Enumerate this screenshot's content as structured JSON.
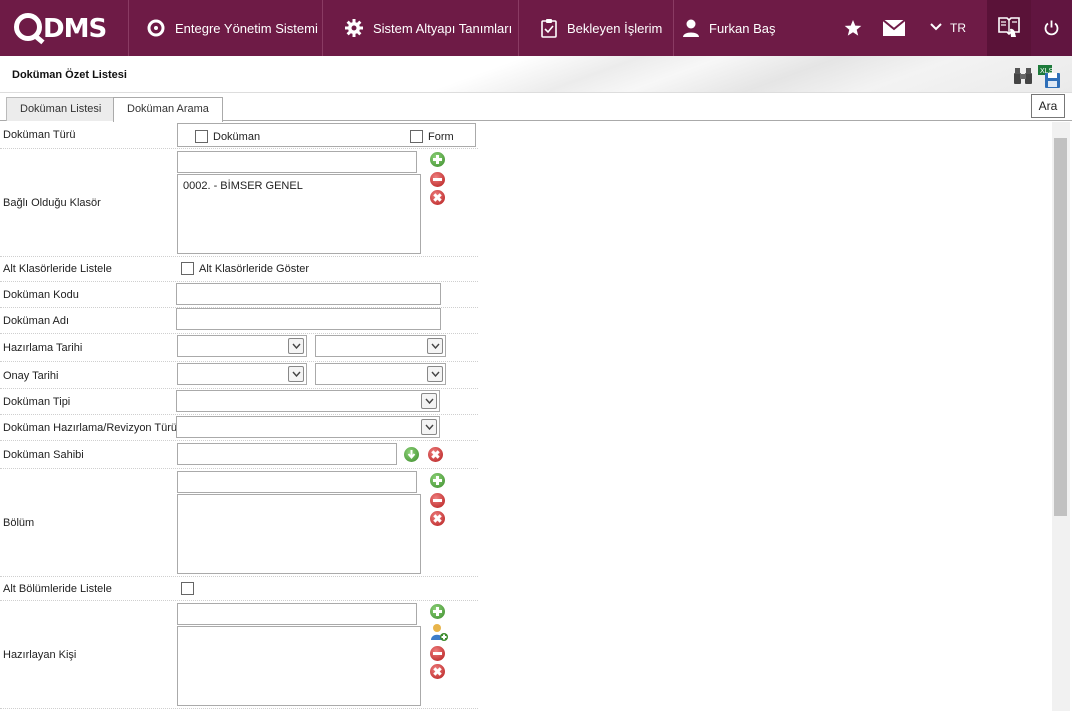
{
  "app": {
    "logo": "QDMS",
    "nav": [
      {
        "label": "Entegre Yönetim Sistemi",
        "icon": "q-logo-icon"
      },
      {
        "label": "Sistem Altyapı Tanımları",
        "icon": "gear-icon"
      },
      {
        "label": "Bekleyen İşlerim",
        "icon": "clipboard-icon"
      },
      {
        "label": "Furkan Baş",
        "icon": "user-icon"
      }
    ],
    "language": "TR",
    "brand_color": "#6e1b46"
  },
  "page": {
    "title": "Doküman Özet Listesi",
    "search_tooltip": "Ara"
  },
  "tabs": [
    {
      "label": "Doküman Listesi",
      "active": false
    },
    {
      "label": "Doküman Arama",
      "active": true
    }
  ],
  "form": {
    "doc_type": {
      "label": "Doküman Türü",
      "option1": "Doküman",
      "option2": "Form"
    },
    "folder": {
      "label": "Bağlı Olduğu Klasör",
      "items": [
        "0002. - BİMSER GENEL"
      ]
    },
    "list_subfolders": {
      "label": "Alt Klasörleride Listele",
      "checkbox_label": "Alt Klasörleride Göster"
    },
    "doc_code": {
      "label": "Doküman Kodu",
      "value": ""
    },
    "doc_name": {
      "label": "Doküman Adı",
      "value": ""
    },
    "prep_date": {
      "label": "Hazırlama Tarihi"
    },
    "approval_date": {
      "label": "Onay Tarihi"
    },
    "doc_kind": {
      "label": "Doküman Tipi"
    },
    "revision_type": {
      "label": "Doküman Hazırlama/Revizyon Türü"
    },
    "doc_owner": {
      "label": "Doküman Sahibi"
    },
    "department": {
      "label": "Bölüm"
    },
    "list_subdepartments": {
      "label": "Alt Bölümleride Listele"
    },
    "preparer": {
      "label": "Hazırlayan Kişi"
    }
  }
}
